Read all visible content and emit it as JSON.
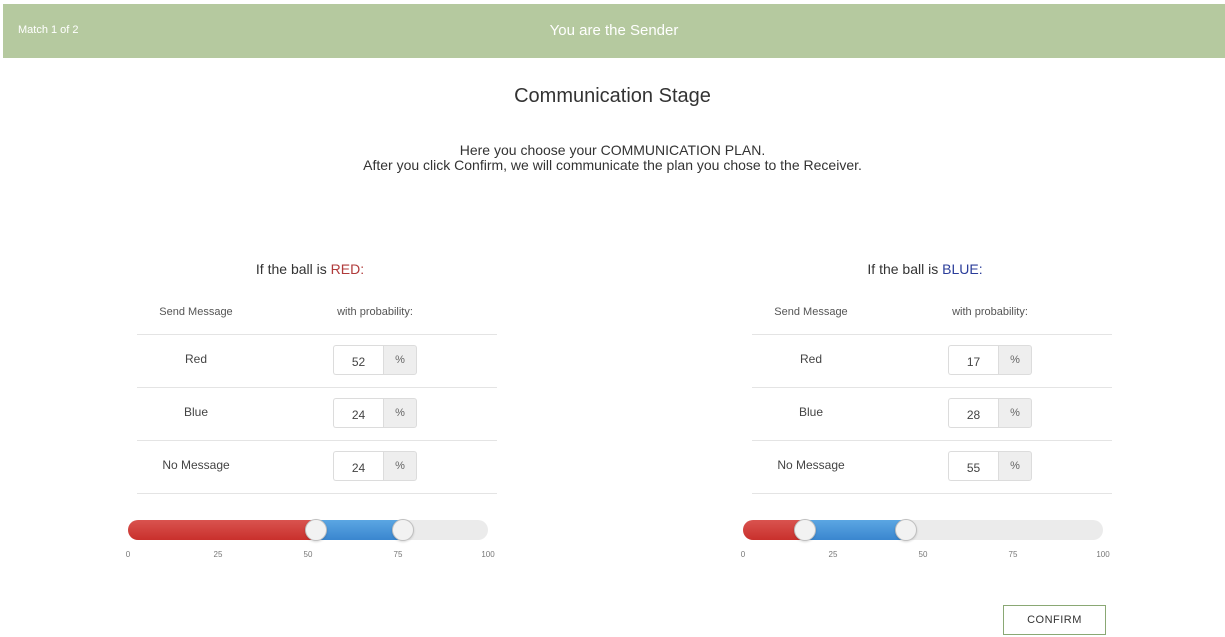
{
  "header": {
    "match_label": "Match 1 of 2",
    "role_label": "You are the Sender",
    "bg_color": "#b5c99f"
  },
  "stage_title": "Communication Stage",
  "instructions": {
    "line1": "Here you choose your COMMUNICATION PLAN.",
    "line2": "After you click Confirm, we will communicate the plan you chose to the Receiver."
  },
  "panels": [
    {
      "heading_prefix": "If the ball is ",
      "color_word": "RED",
      "heading_suffix": ":",
      "col_message": "Send Message",
      "col_probability": "with probability:",
      "rows": [
        {
          "label": "Red",
          "value": "52",
          "unit": "%"
        },
        {
          "label": "Blue",
          "value": "24",
          "unit": "%"
        },
        {
          "label": "No Message",
          "value": "24",
          "unit": "%"
        }
      ],
      "slider": {
        "red_end": 52,
        "blue_end": 76
      }
    },
    {
      "heading_prefix": "If the ball is ",
      "color_word": "BLUE",
      "heading_suffix": ":",
      "col_message": "Send Message",
      "col_probability": "with probability:",
      "rows": [
        {
          "label": "Red",
          "value": "17",
          "unit": "%"
        },
        {
          "label": "Blue",
          "value": "28",
          "unit": "%"
        },
        {
          "label": "No Message",
          "value": "55",
          "unit": "%"
        }
      ],
      "slider": {
        "red_end": 17,
        "blue_end": 45
      }
    }
  ],
  "slider_scale": [
    "0",
    "25",
    "50",
    "75",
    "100"
  ],
  "colors": {
    "red_word": "#b03a3a",
    "blue_word": "#2b3d9a",
    "slider_red": "#d9534f",
    "slider_blue": "#3a86cf"
  },
  "confirm_label": "CONFIRM"
}
